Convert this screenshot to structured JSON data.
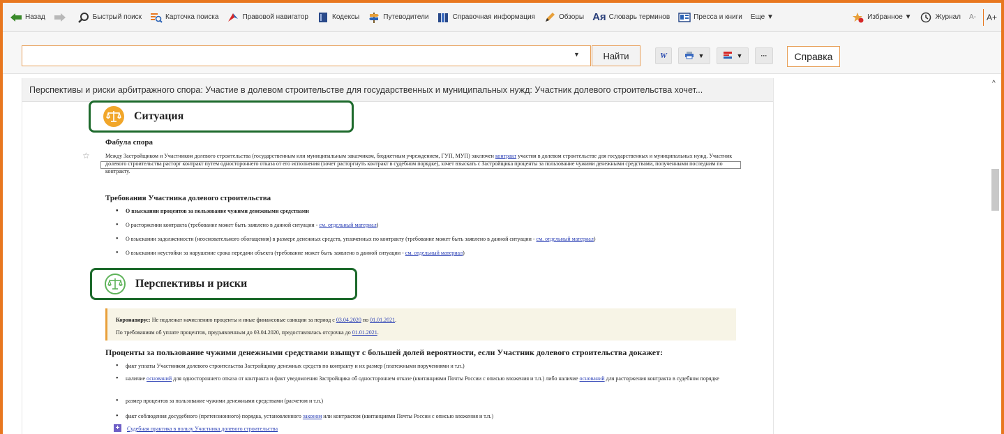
{
  "toolbar": {
    "back": "Назад",
    "quick_search": "Быстрый поиск",
    "search_card": "Карточка поиска",
    "legal_navigator": "Правовой навигатор",
    "codes": "Кодексы",
    "guides": "Путеводители",
    "reference": "Справочная информация",
    "reviews": "Обзоры",
    "terms_glyph": "Ая",
    "terms": "Словарь терминов",
    "press": "Пресса и книги",
    "more": "Еще ▼",
    "favorites": "Избранное ▼",
    "journal": "Журнал",
    "font_smaller": "A-",
    "font_bigger": "A+",
    "accent_color": "#e8771f"
  },
  "search": {
    "value": "",
    "find_label": "Найти",
    "help_label": "Справка",
    "more_glyph": "···",
    "w_glyph": "W"
  },
  "doc": {
    "title": "Перспективы и риски арбитражного спора: Участие в долевом строительстве для государственных и муниципальных нужд: Участник долевого строительства хочет...",
    "situation_title": "Ситуация",
    "plot_heading": "Фабула спора",
    "plot_text_1": "Между Застройщиком и Участником долевого строительства (государственным или муниципальным заказчиком, бюджетным учреждением, ГУП, МУП) заключен",
    "plot_link": "контракт",
    "plot_text_2": "участия в долевом строительстве для государственных и муниципальных нужд. Участник долевого строительства расторг контракт путем одностороннего отказа от его исполнения (хочет расторгнуть контракт в судебном порядке), хочет взыскать с Застройщика проценты за пользование чужими денежными средствами, полученными последним по контракту.",
    "claims_heading": "Требования Участника долевого строительства",
    "claims": [
      {
        "text": "О взыскании процентов за пользование чужими денежными средствами",
        "link": ""
      },
      {
        "text": "О расторжении контракта (требование может быть заявлено в данной ситуации - ",
        "link": "см. отдельный материал"
      },
      {
        "text": "О взыскании задолженности (неосновательного обогащения) в размере денежных средств, уплаченных по контракту (требование может быть заявлено в данной ситуации - ",
        "link": "см. отдельный материал"
      },
      {
        "text": "О взыскании неустойки за нарушение срока передачи объекта (требование может быть заявлено в данной ситуации - ",
        "link": "см. отдельный материал"
      }
    ],
    "risks_title": "Перспективы и риски",
    "note_label": "Коронавирус:",
    "note_line1_a": "Не подлежат начислению проценты и иные финансовые санкции за период с",
    "note_date1": "03.04.2020",
    "note_line1_b": "по",
    "note_date2": "01.01.2021",
    "note_line2_a": "По требованиям об уплате процентов, предъявленным до 03.04.2020, предоставлялась отсрочка до",
    "note_date3": "01.01.2021",
    "main_heading": "Проценты за пользование чужими денежными средствами взыщут с большей долей вероятности, если Участник долевого строительства докажет:",
    "proofs": [
      {
        "a": "факт уплаты Участником долевого строительства Застройщику денежных средств по контракту и их размер (платежными поручениями и т.п.)",
        "l1": "",
        "b": "",
        "l2": "",
        "c": ""
      },
      {
        "a": "наличие ",
        "l1": "оснований",
        "b": " для одностороннего отказа от контракта и факт уведомления Застройщика об одностороннем отказе (квитанциями Почты России с описью вложения и т.п.) либо наличие ",
        "l2": "оснований",
        "c": " для расторжения контракта в судебном порядке"
      },
      {
        "a": "размер процентов за пользование чужими денежными средствами (расчетом и т.п.)",
        "l1": "",
        "b": "",
        "l2": "",
        "c": ""
      },
      {
        "a": "факт соблюдения досудебного (претензионного) порядка, установленного ",
        "l1": "законом",
        "b": " или контрактом (квитанциями Почты России с описью вложения и т.п.)",
        "l2": "",
        "c": ""
      }
    ],
    "practice_link": "Судебная практика в пользу Участника долевого строительства",
    "highlight_color": "#1d6a2c"
  }
}
